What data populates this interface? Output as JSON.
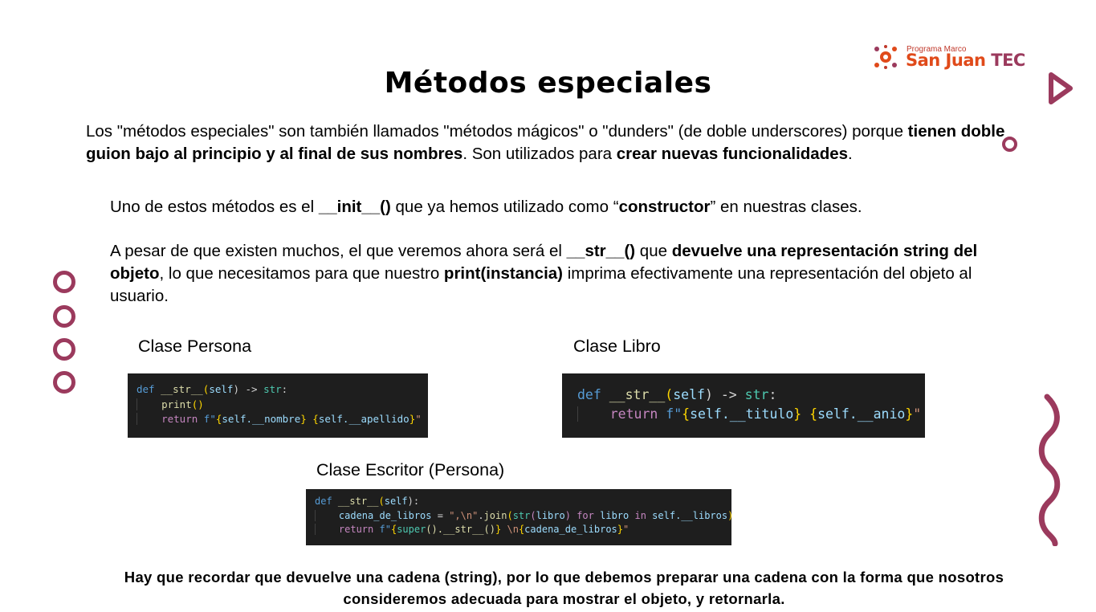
{
  "slide": {
    "title": "Métodos especiales",
    "logo": {
      "small": "Programa Marco",
      "main": "San Juan",
      "tec": "TEC"
    },
    "intro": {
      "t1": "Los \"métodos especiales\" son también llamados \"métodos mágicos\" o \"dunders\" (de doble underscores) porque ",
      "b1": "tienen doble guion bajo al principio y al final de sus nombres",
      "t2": ". Son utilizados para ",
      "b2": "crear nuevas funcionalidades",
      "t3": "."
    },
    "para2": {
      "t1": "Uno de estos métodos es el ",
      "b1": "__init__()",
      "t2": " que ya hemos utilizado como “",
      "b2": "constructor",
      "t3": "” en nuestras clases."
    },
    "para3": {
      "t1": "A pesar de que existen muchos, el que veremos ahora será el ",
      "b1": "__str__()",
      "t2": " que ",
      "b2": "devuelve una representación string del objeto",
      "t3": ", lo que necesitamos para que nuestro ",
      "b3": "print(instancia)",
      "t4": " imprima efectivamente una representación del objeto al usuario."
    },
    "captions": {
      "persona": "Clase Persona",
      "libro": "Clase Libro",
      "escritor": "Clase Escritor (Persona)"
    },
    "footer": "Hay que recordar que devuelve una cadena (string), por lo que debemos preparar una cadena con la forma que nosotros consideremos adecuada para mostrar el objeto, y retornarla.",
    "colors": {
      "accent": "#9b3a5d",
      "logo_orange": "#e04a1a",
      "code_bg": "#1e1e1e"
    }
  },
  "code": {
    "persona": {
      "def": "def",
      "name": "__str__",
      "self": "self",
      "arrow": ") -> ",
      "type": "str",
      "colon": ":",
      "print": "print",
      "print_parens": "()",
      "ret": "return",
      "f": "f\"",
      "v1": "self.__nombre",
      "v2": "self.__apellido",
      "end": "\""
    },
    "libro": {
      "def": "def",
      "name": "__str__",
      "self": "self",
      "arrow": ") -> ",
      "type": "str",
      "colon": ":",
      "ret": "return",
      "f": "f\"",
      "v1": "self.__titulo",
      "v2": "self.__anio",
      "end": "\""
    },
    "escritor": {
      "def": "def",
      "name": "__str__",
      "self": "self",
      "colon": "):",
      "var": "cadena_de_libros",
      "eq": " = ",
      "sep": "\",\\n\"",
      "join": "join",
      "str": "str",
      "libro": "libro",
      "for": "for",
      "in": "in",
      "libros": "self.__libros",
      "ret": "return",
      "f": "f\"",
      "super": "super",
      "inner": "().__str__()",
      "nl": " \\n",
      "v": "cadena_de_libros",
      "end": "\""
    }
  }
}
